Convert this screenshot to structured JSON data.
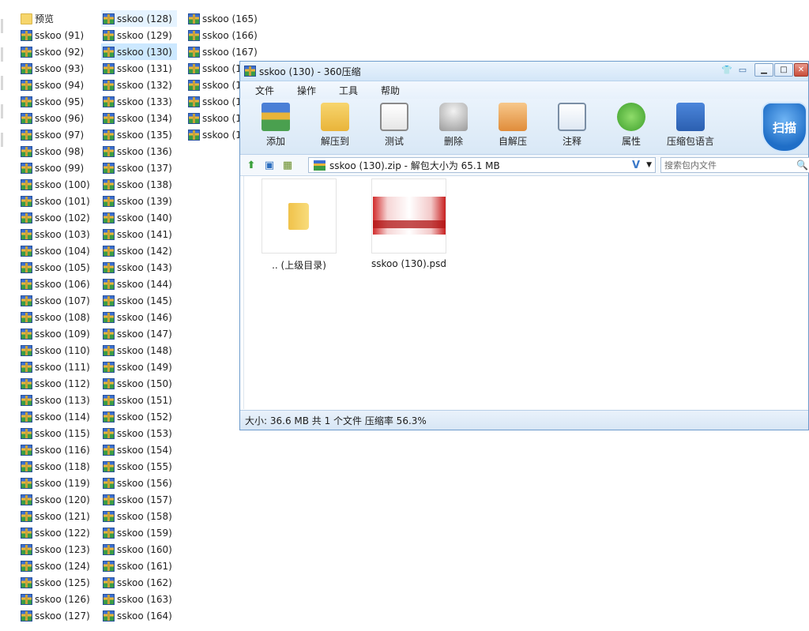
{
  "explorer": {
    "columns": [
      [
        "预览",
        "sskoo (91)",
        "sskoo (92)",
        "sskoo (93)",
        "sskoo (94)",
        "sskoo (95)",
        "sskoo (96)",
        "sskoo (97)",
        "sskoo (98)",
        "sskoo (99)",
        "sskoo (100)",
        "sskoo (101)",
        "sskoo (102)",
        "sskoo (103)",
        "sskoo (104)",
        "sskoo (105)",
        "sskoo (106)",
        "sskoo (107)",
        "sskoo (108)",
        "sskoo (109)",
        "sskoo (110)",
        "sskoo (111)",
        "sskoo (112)",
        "sskoo (113)",
        "sskoo (114)",
        "sskoo (115)",
        "sskoo (116)",
        "sskoo (118)",
        "sskoo (119)",
        "sskoo (120)",
        "sskoo (121)",
        "sskoo (122)",
        "sskoo (123)",
        "sskoo (124)",
        "sskoo (125)",
        "sskoo (126)",
        "sskoo (127)"
      ],
      [
        "sskoo (128)",
        "sskoo (129)",
        "sskoo (130)",
        "sskoo (131)",
        "sskoo (132)",
        "sskoo (133)",
        "sskoo (134)",
        "sskoo (135)",
        "sskoo (136)",
        "sskoo (137)",
        "sskoo (138)",
        "sskoo (139)",
        "sskoo (140)",
        "sskoo (141)",
        "sskoo (142)",
        "sskoo (143)",
        "sskoo (144)",
        "sskoo (145)",
        "sskoo (146)",
        "sskoo (147)",
        "sskoo (148)",
        "sskoo (149)",
        "sskoo (150)",
        "sskoo (151)",
        "sskoo (152)",
        "sskoo (153)",
        "sskoo (154)",
        "sskoo (155)",
        "sskoo (156)",
        "sskoo (157)",
        "sskoo (158)",
        "sskoo (159)",
        "sskoo (160)",
        "sskoo (161)",
        "sskoo (162)",
        "sskoo (163)",
        "sskoo (164)"
      ],
      [
        "sskoo (165)",
        "sskoo (166)",
        "sskoo (167)",
        "sskoo (1",
        "sskoo (1",
        "sskoo (1",
        "sskoo (1",
        "sskoo (1"
      ]
    ],
    "hover_item": "sskoo (128)",
    "selected_item": "sskoo (130)",
    "folder_item": "预览"
  },
  "window": {
    "title": "sskoo (130) - 360压缩",
    "title_buttons": [
      "shirt-icon",
      "message-icon"
    ],
    "minimize": "▁",
    "maximize": "□",
    "close": "✕",
    "menu": [
      "文件",
      "操作",
      "工具",
      "帮助"
    ],
    "toolbar": [
      {
        "label": "添加",
        "icon": "add-icon"
      },
      {
        "label": "解压到",
        "icon": "extract-to-icon"
      },
      {
        "label": "测试",
        "icon": "test-icon"
      },
      {
        "label": "删除",
        "icon": "delete-icon"
      },
      {
        "label": "自解压",
        "icon": "self-extract-icon"
      },
      {
        "label": "注释",
        "icon": "comment-icon"
      },
      {
        "label": "属性",
        "icon": "properties-icon"
      },
      {
        "label": "压缩包语言",
        "icon": "archive-language-icon"
      }
    ],
    "scan_label": "扫描",
    "path_text": "sskoo (130).zip - 解包大小为 65.1 MB",
    "path_dropdown_v": "V",
    "search_placeholder": "搜索包内文件",
    "files": [
      {
        "name": ".. (上级目录)",
        "type": "folder"
      },
      {
        "name": "sskoo (130).psd",
        "type": "psd"
      }
    ],
    "status": "大小: 36.6 MB 共 1 个文件 压缩率 56.3%"
  }
}
